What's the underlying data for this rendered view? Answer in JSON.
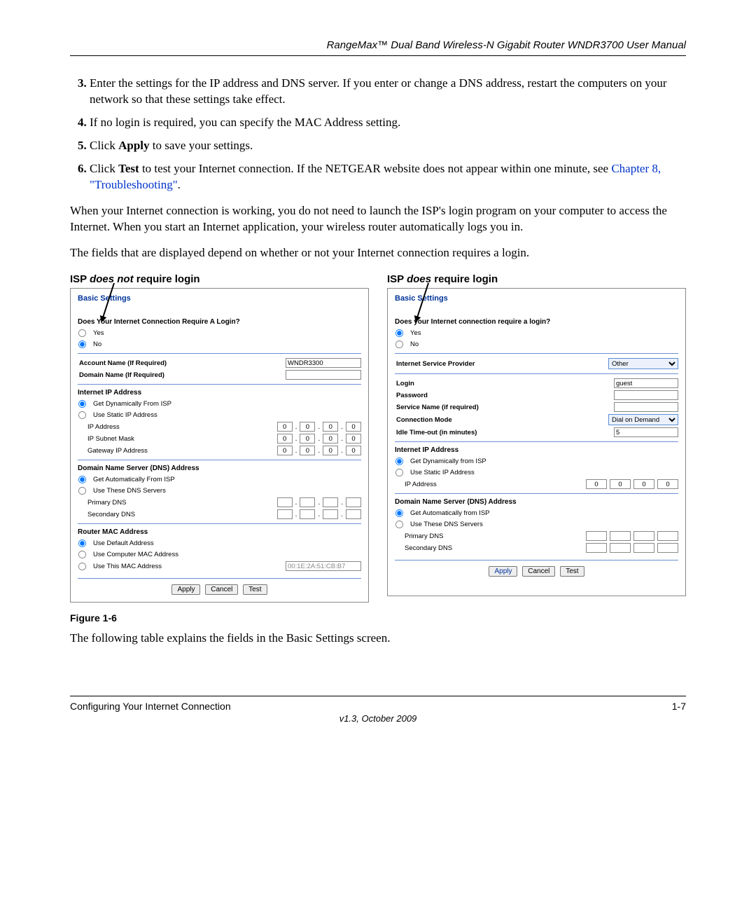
{
  "header": "RangeMax™ Dual Band Wireless-N Gigabit Router WNDR3700 User Manual",
  "steps": {
    "s3": "Enter the settings for the IP address and DNS server. If you enter or change a DNS address, restart the computers on your network so that these settings take effect.",
    "s4": "If no login is required, you can specify the MAC Address setting.",
    "s5a": "Click ",
    "s5b": "Apply",
    "s5c": " to save your settings.",
    "s6a": "Click ",
    "s6b": "Test",
    "s6c": " to test your Internet connection. If the NETGEAR website does not appear within one minute, see ",
    "s6link": "Chapter 8, \"Troubleshooting\""
  },
  "para1": "When your Internet connection is working, you do not need to launch the ISP's login program on your computer to access the Internet. When you start an Internet application, your wireless router automatically logs you in.",
  "para2": "The fields that are displayed depend on whether or not your Internet connection requires a login.",
  "left": {
    "title_a": "ISP ",
    "title_b": "does not",
    "title_c": " require login",
    "panel_title": "Basic Settings",
    "q": "Does Your Internet Connection Require A Login?",
    "yes": "Yes",
    "no": "No",
    "account_lab": "Account Name  (If Required)",
    "account_val": "WNDR3300",
    "domain_lab": "Domain Name  (If Required)",
    "iip": "Internet IP Address",
    "iip_dyn": "Get Dynamically From ISP",
    "iip_stat": "Use Static IP Address",
    "ip_addr": "IP Address",
    "subnet": "IP Subnet Mask",
    "gw": "Gateway IP Address",
    "dns_hdr": "Domain Name Server (DNS) Address",
    "dns_auto": "Get Automatically From ISP",
    "dns_use": "Use These DNS Servers",
    "pdns": "Primary DNS",
    "sdns": "Secondary DNS",
    "mac_hdr": "Router MAC Address",
    "mac_def": "Use Default Address",
    "mac_comp": "Use Computer MAC Address",
    "mac_this": "Use This MAC Address",
    "mac_val": "00:1E:2A:51:CB:B7",
    "apply": "Apply",
    "cancel": "Cancel",
    "test": "Test"
  },
  "right": {
    "title_a": "ISP ",
    "title_b": "does",
    "title_c": " require login",
    "panel_title": "Basic Settings",
    "q": "Does your Internet connection require a login?",
    "yes": "Yes",
    "no": "No",
    "isp_lab": "Internet Service Provider",
    "isp_val": "Other",
    "login_lab": "Login",
    "login_val": "guest",
    "pwd_lab": "Password",
    "svc_lab": "Service Name (if required)",
    "cmode_lab": "Connection Mode",
    "cmode_val": "Dial on Demand",
    "idle_lab": "Idle Time-out (in minutes)",
    "idle_val": "5",
    "iip": "Internet IP Address",
    "iip_dyn": "Get Dynamically from ISP",
    "iip_stat": "Use Static IP Address",
    "ip_addr": "IP Address",
    "dns_hdr": "Domain Name Server (DNS) Address",
    "dns_auto": "Get Automatically from ISP",
    "dns_use": "Use These DNS Servers",
    "pdns": "Primary DNS",
    "sdns": "Secondary DNS",
    "apply": "Apply",
    "cancel": "Cancel",
    "test": "Test"
  },
  "figcap": "Figure 1-6",
  "para3": "The following table explains the fields in the Basic Settings screen.",
  "footer": {
    "left": "Configuring Your Internet Connection",
    "right": "1-7",
    "ver": "v1.3, October 2009"
  }
}
